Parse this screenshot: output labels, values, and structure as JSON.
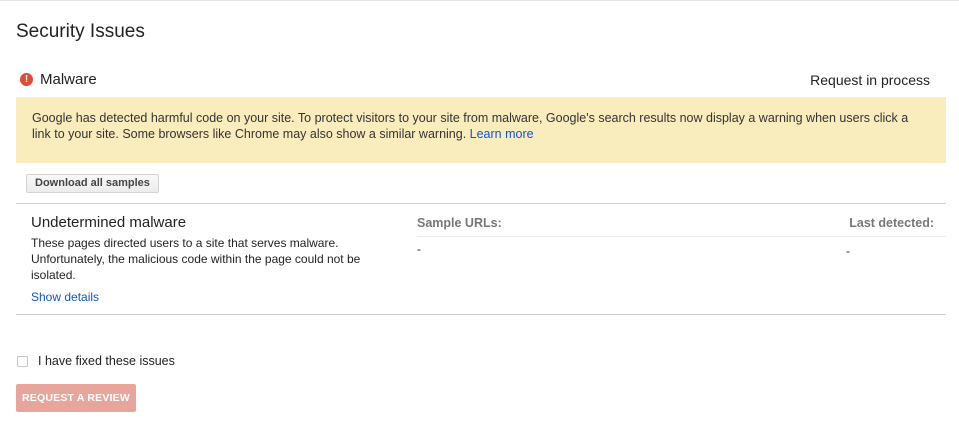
{
  "page": {
    "title": "Security Issues"
  },
  "issue": {
    "icon": "exclamation-icon",
    "icon_glyph": "!",
    "title": "Malware",
    "status": "Request in process",
    "alert_text": "Google has detected harmful code on your site. To protect visitors to your site from malware, Google's search results now display a warning when users click a link to your site. Some browsers like Chrome may also show a similar warning. ",
    "alert_link": "Learn more",
    "download_label": "Download all samples"
  },
  "details": {
    "type_title": "Undetermined malware",
    "type_description": "These pages directed users to a site that serves malware. Unfortunately, the malicious code within the page could not be isolated.",
    "show_details": "Show details",
    "col_sample_urls": "Sample URLs:",
    "col_last_detected": "Last detected:",
    "sample_urls_value": "-",
    "last_detected_value": "-"
  },
  "footer": {
    "checkbox_label": "I have fixed these issues",
    "checkbox_checked": false,
    "review_button": "REQUEST A REVIEW"
  },
  "colors": {
    "alert_background": "#f9edbe",
    "link": "#1155cc",
    "error_icon": "#dd4b39",
    "review_button_disabled": "#e8a59b"
  }
}
